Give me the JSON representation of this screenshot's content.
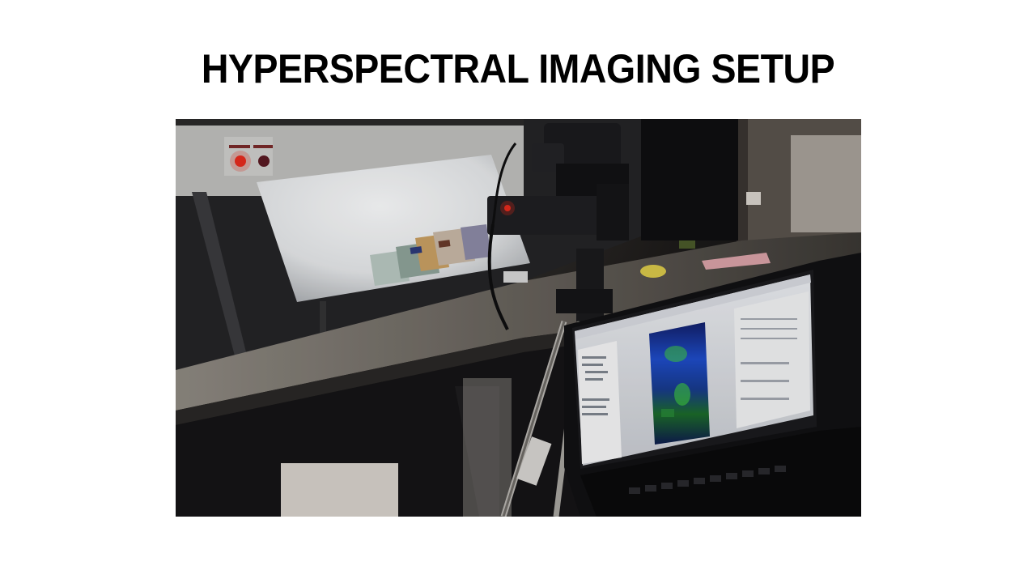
{
  "slide": {
    "title": "HYPERSPECTRAL IMAGING SETUP"
  },
  "photo": {
    "subject": "Hyperspectral camera on a tripod pointed at a light box holding banknotes, with a laptop displaying the imaging software",
    "icons": [
      "light-box",
      "hyperspectral-camera",
      "tripod",
      "banknotes",
      "laptop",
      "software-window"
    ]
  },
  "colors": {
    "title": "#000000",
    "background": "#ffffff",
    "indicator_red": "#e62b1e",
    "screen_glow": "#eef0f2",
    "hyperspectral_blue": "#1f4cc9",
    "hyperspectral_green": "#3fd13a"
  }
}
